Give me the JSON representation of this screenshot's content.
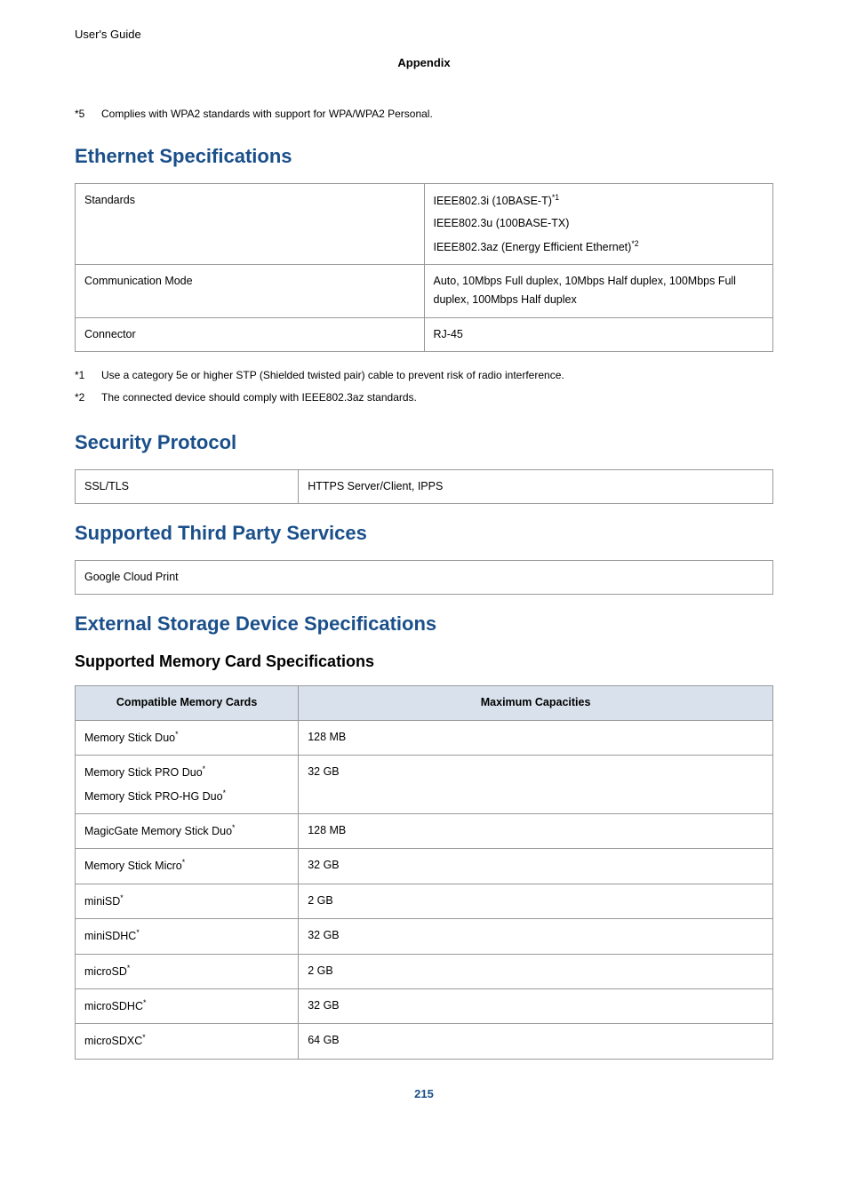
{
  "header": {
    "guide": "User's Guide",
    "section": "Appendix"
  },
  "top_note": {
    "marker": "*5",
    "text": "Complies with WPA2 standards with support for WPA/WPA2 Personal."
  },
  "ethernet": {
    "heading": "Ethernet Specifications",
    "rows": {
      "standards_label": "Standards",
      "standards_v1_pre": "IEEE802.3i (10BASE-T)",
      "standards_v1_sup": "*1",
      "standards_v2": "IEEE802.3u (100BASE-TX)",
      "standards_v3_pre": "IEEE802.3az (Energy Efficient Ethernet)",
      "standards_v3_sup": "*2",
      "comm_label": "Communication Mode",
      "comm_value": "Auto, 10Mbps Full duplex, 10Mbps Half duplex, 100Mbps Full duplex, 100Mbps Half duplex",
      "conn_label": "Connector",
      "conn_value": "RJ-45"
    },
    "footnotes": {
      "f1_marker": "*1",
      "f1_text": "Use a category 5e or higher STP (Shielded twisted pair) cable to prevent risk of radio interference.",
      "f2_marker": "*2",
      "f2_text": "The connected device should comply with IEEE802.3az standards."
    }
  },
  "security": {
    "heading": "Security Protocol",
    "label": "SSL/TLS",
    "value": "HTTPS Server/Client, IPPS"
  },
  "third_party": {
    "heading": "Supported Third Party Services",
    "value": "Google Cloud Print"
  },
  "external_storage": {
    "heading": "External Storage Device Specifications",
    "sub_heading": "Supported Memory Card Specifications",
    "col1": "Compatible Memory Cards",
    "col2": "Maximum Capacities",
    "r1_c1": "Memory Stick Duo",
    "r1_sup": "*",
    "r1_c2": "128 MB",
    "r2_c1a": "Memory Stick PRO Duo",
    "r2_supa": "*",
    "r2_c1b": "Memory Stick PRO-HG Duo",
    "r2_supb": "*",
    "r2_c2": "32 GB",
    "r3_c1": "MagicGate Memory Stick Duo",
    "r3_sup": "*",
    "r3_c2": "128 MB",
    "r4_c1": "Memory Stick Micro",
    "r4_sup": "*",
    "r4_c2": "32 GB",
    "r5_c1": "miniSD",
    "r5_sup": "*",
    "r5_c2": "2 GB",
    "r6_c1": "miniSDHC",
    "r6_sup": "*",
    "r6_c2": "32 GB",
    "r7_c1": "microSD",
    "r7_sup": "*",
    "r7_c2": "2 GB",
    "r8_c1": "microSDHC",
    "r8_sup": "*",
    "r8_c2": "32 GB",
    "r9_c1": "microSDXC",
    "r9_sup": "*",
    "r9_c2": "64 GB"
  },
  "page_number": "215"
}
